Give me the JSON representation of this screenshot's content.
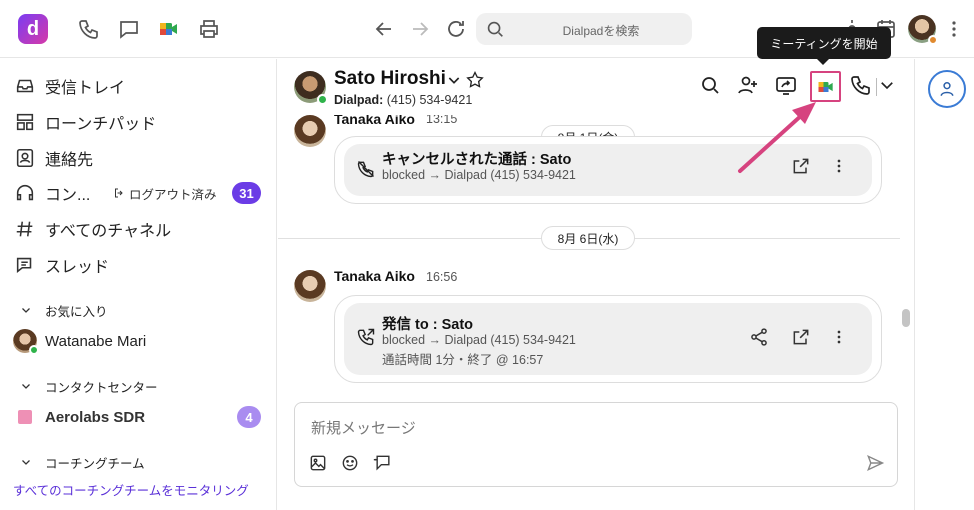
{
  "topbar": {
    "logo_letter": "d",
    "search_placeholder": "Dialpadを検索",
    "tooltip": "ミーティングを開始"
  },
  "sidebar": {
    "items": [
      {
        "label": "受信トレイ",
        "icon": "inbox-icon"
      },
      {
        "label": "ローンチパッド",
        "icon": "launchpad-icon"
      },
      {
        "label": "連絡先",
        "icon": "contacts-icon"
      },
      {
        "label": "コン...",
        "icon": "headset-icon",
        "sub": "ログアウト済み",
        "badge": "31"
      },
      {
        "label": "すべてのチャネル",
        "icon": "hash-icon"
      },
      {
        "label": "スレッド",
        "icon": "threads-icon"
      }
    ],
    "favorites": {
      "title": "お気に入り",
      "items": [
        {
          "label": "Watanabe Mari"
        }
      ]
    },
    "contact_center": {
      "title": "コンタクトセンター",
      "items": [
        {
          "label": "Aerolabs SDR",
          "badge": "4"
        }
      ]
    },
    "coaching": {
      "title": "コーチングチーム",
      "link": "すべてのコーチングチームをモニタリング"
    }
  },
  "channel": {
    "name": "Sato Hiroshi",
    "phone_label": "Dialpad:",
    "phone": "(415) 534-9421"
  },
  "messages": [
    {
      "sender": "Tanaka Aiko",
      "time": "13:15",
      "date": "8月 1日(金)",
      "title": "キャンセルされた通話 : Sato",
      "line1": "blocked → Dialpad (415) 534-9421"
    },
    {
      "sender": "Tanaka Aiko",
      "time": "16:56",
      "date": "8月 6日(水)",
      "title": "発信 to : Sato",
      "line1": "blocked → Dialpad (415) 534-9421",
      "line2": "通話時間 1分・終了 @ 16:57"
    }
  ],
  "composer": {
    "placeholder": "新規メッセージ"
  },
  "colors": {
    "accent": "#6b3ce6",
    "highlight": "#d6437f",
    "online": "#2fb34a"
  }
}
